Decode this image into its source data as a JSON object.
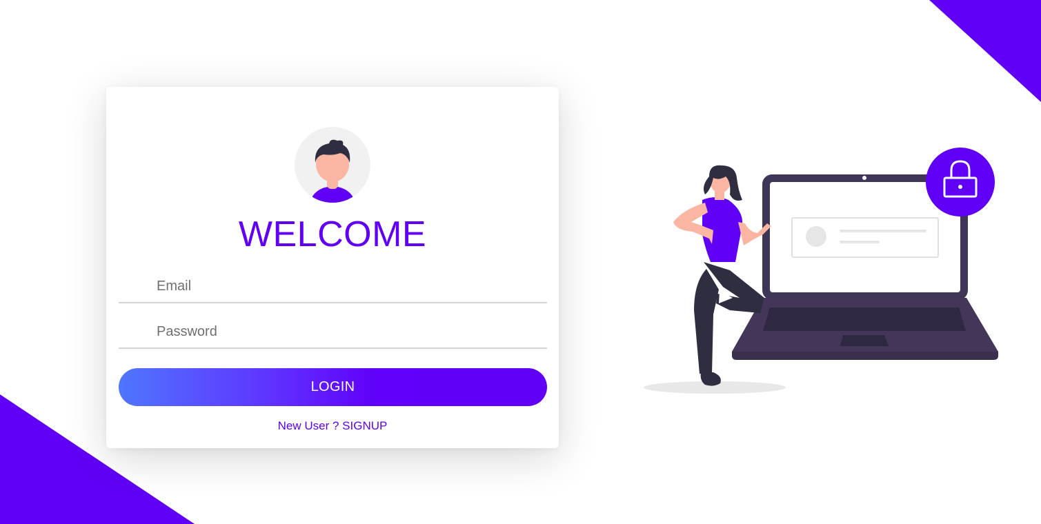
{
  "colors": {
    "accent": "#6000f7",
    "gradient_start": "#4f76ff",
    "laptop_dark": "#3f3556",
    "skin": "#fbb6a3",
    "hair": "#2f2e41"
  },
  "login": {
    "title": "WELCOME",
    "avatar_icon": "user-avatar-icon",
    "email_placeholder": "Email",
    "password_placeholder": "Password",
    "submit_label": "LOGIN",
    "signup_text": "New User ? SIGNUP"
  },
  "illustration": {
    "name": "woman-with-laptop-illustration",
    "lock_icon": "padlock-icon"
  }
}
